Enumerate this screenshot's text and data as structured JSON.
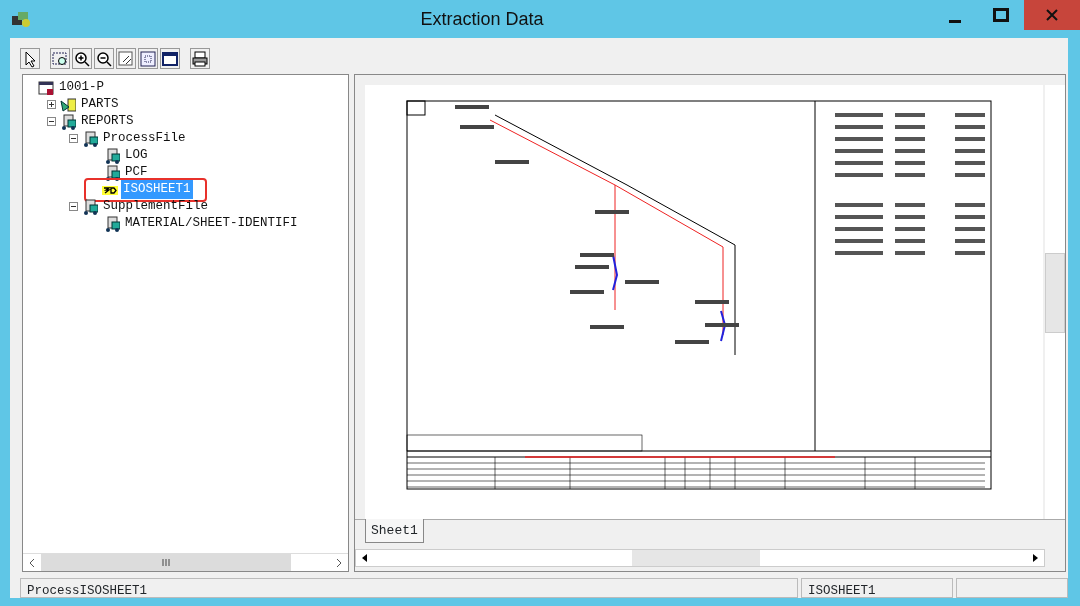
{
  "window": {
    "title": "Extraction Data"
  },
  "tree": [
    {
      "label": "1001-P",
      "kind": "root",
      "selected": false,
      "annotated": false,
      "children": [
        {
          "label": "PARTS",
          "kind": "parts",
          "expanded": false,
          "selected": false,
          "annotated": false
        },
        {
          "label": "REPORTS",
          "kind": "folder",
          "expanded": true,
          "selected": false,
          "annotated": false,
          "children": [
            {
              "label": "ProcessFile",
              "kind": "folder",
              "expanded": true,
              "selected": false,
              "annotated": false,
              "children": [
                {
                  "label": "LOG",
                  "kind": "folder",
                  "selected": false,
                  "annotated": false
                },
                {
                  "label": "PCF",
                  "kind": "folder",
                  "selected": false,
                  "annotated": false
                },
                {
                  "label": "ISOSHEET1",
                  "kind": "sheet",
                  "selected": true,
                  "annotated": true
                }
              ]
            },
            {
              "label": "SupplementFile",
              "kind": "folder",
              "expanded": true,
              "selected": false,
              "annotated": false,
              "children": [
                {
                  "label": "MATERIAL/SHEET-IDENTIFI",
                  "kind": "folder",
                  "selected": false,
                  "annotated": false
                }
              ]
            }
          ]
        }
      ]
    }
  ],
  "sheet_tabs": [
    {
      "label": "Sheet1",
      "selected": true
    }
  ],
  "status_bar": [
    "ProcessISOSHEET1",
    "ISOSHEET1"
  ]
}
